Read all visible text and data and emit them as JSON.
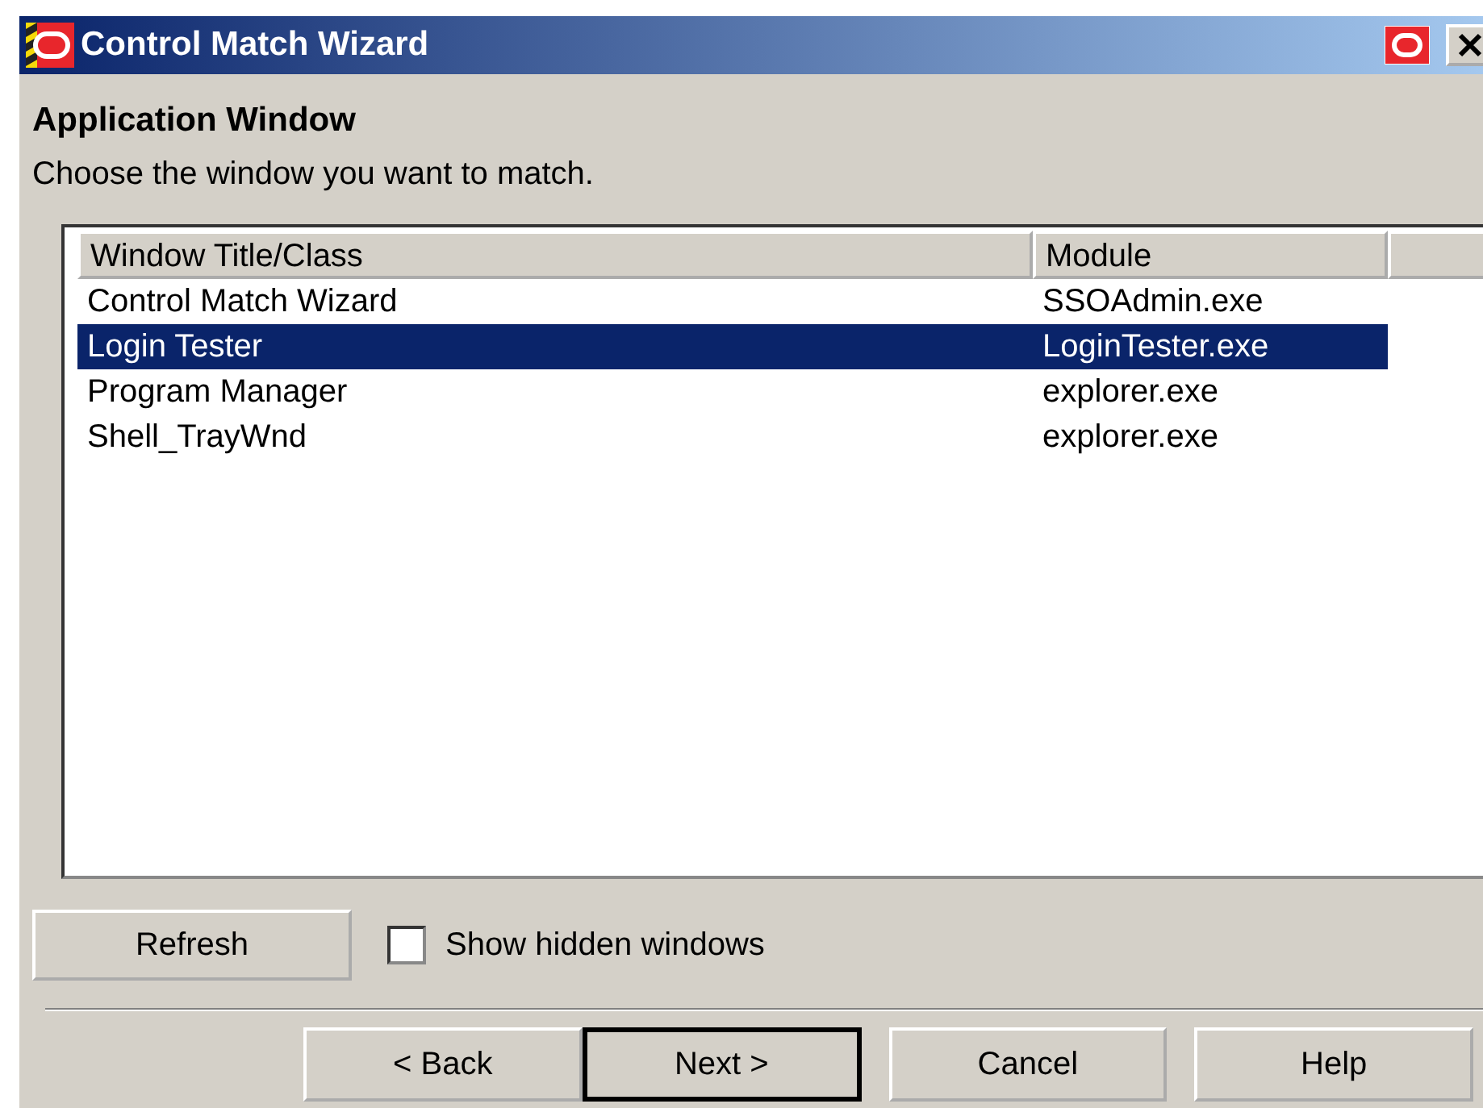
{
  "window": {
    "title": "Control Match Wizard"
  },
  "heading": "Application Window",
  "instruction": "Choose the window you want to match.",
  "table": {
    "columns": [
      "Window Title/Class",
      "Module"
    ],
    "rows": [
      {
        "title": "Control Match Wizard",
        "module": "SSOAdmin.exe",
        "selected": false
      },
      {
        "title": "Login Tester",
        "module": "LoginTester.exe",
        "selected": true
      },
      {
        "title": "Program Manager",
        "module": "explorer.exe",
        "selected": false
      },
      {
        "title": "Shell_TrayWnd",
        "module": "explorer.exe",
        "selected": false
      }
    ]
  },
  "refresh_button": "Refresh",
  "show_hidden": {
    "label": "Show hidden windows",
    "checked": false
  },
  "buttons": [
    {
      "label": "< Back",
      "default": false
    },
    {
      "label": "Next >",
      "default": true
    },
    {
      "label": "Cancel",
      "default": false
    },
    {
      "label": "Help",
      "default": false
    }
  ]
}
